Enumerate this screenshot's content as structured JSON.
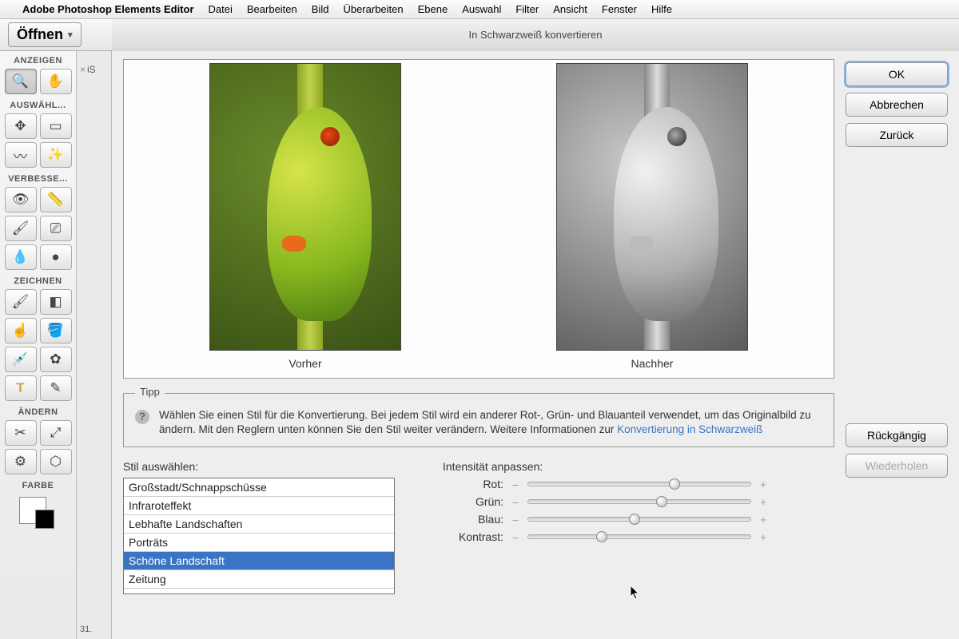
{
  "menubar": {
    "app": "Adobe Photoshop Elements Editor",
    "items": [
      "Datei",
      "Bearbeiten",
      "Bild",
      "Überarbeiten",
      "Ebene",
      "Auswahl",
      "Filter",
      "Ansicht",
      "Fenster",
      "Hilfe"
    ]
  },
  "open_button": "Öffnen",
  "dialog_title": "In Schwarzweiß konvertieren",
  "doc_tab": "iS",
  "zoom": "31.",
  "toolbox": {
    "sections": [
      "ANZEIGEN",
      "AUSWÄHL...",
      "VERBESSE...",
      "ZEICHNEN",
      "ÄNDERN",
      "FARBE"
    ]
  },
  "preview": {
    "before": "Vorher",
    "after": "Nachher"
  },
  "tip": {
    "legend": "Tipp",
    "text": "Wählen Sie einen Stil für die Konvertierung. Bei jedem Stil wird ein anderer Rot-, Grün- und Blauanteil verwendet, um das Originalbild zu ändern. Mit den Reglern unten können Sie den Stil weiter verändern. Weitere Informationen zur ",
    "link": "Konvertierung in Schwarzweiß"
  },
  "style": {
    "label": "Stil auswählen:",
    "items": [
      "Großstadt/Schnappschüsse",
      "Infraroteffekt",
      "Lebhafte Landschaften",
      "Porträts",
      "Schöne Landschaft",
      "Zeitung"
    ],
    "selected_index": 4
  },
  "intensity": {
    "label": "Intensität anpassen:",
    "sliders": [
      {
        "name": "Rot:",
        "value": 66
      },
      {
        "name": "Grün:",
        "value": 60
      },
      {
        "name": "Blau:",
        "value": 48
      },
      {
        "name": "Kontrast:",
        "value": 33
      }
    ]
  },
  "buttons": {
    "ok": "OK",
    "cancel": "Abbrechen",
    "back": "Zurück",
    "undo": "Rückgängig",
    "redo": "Wiederholen"
  }
}
